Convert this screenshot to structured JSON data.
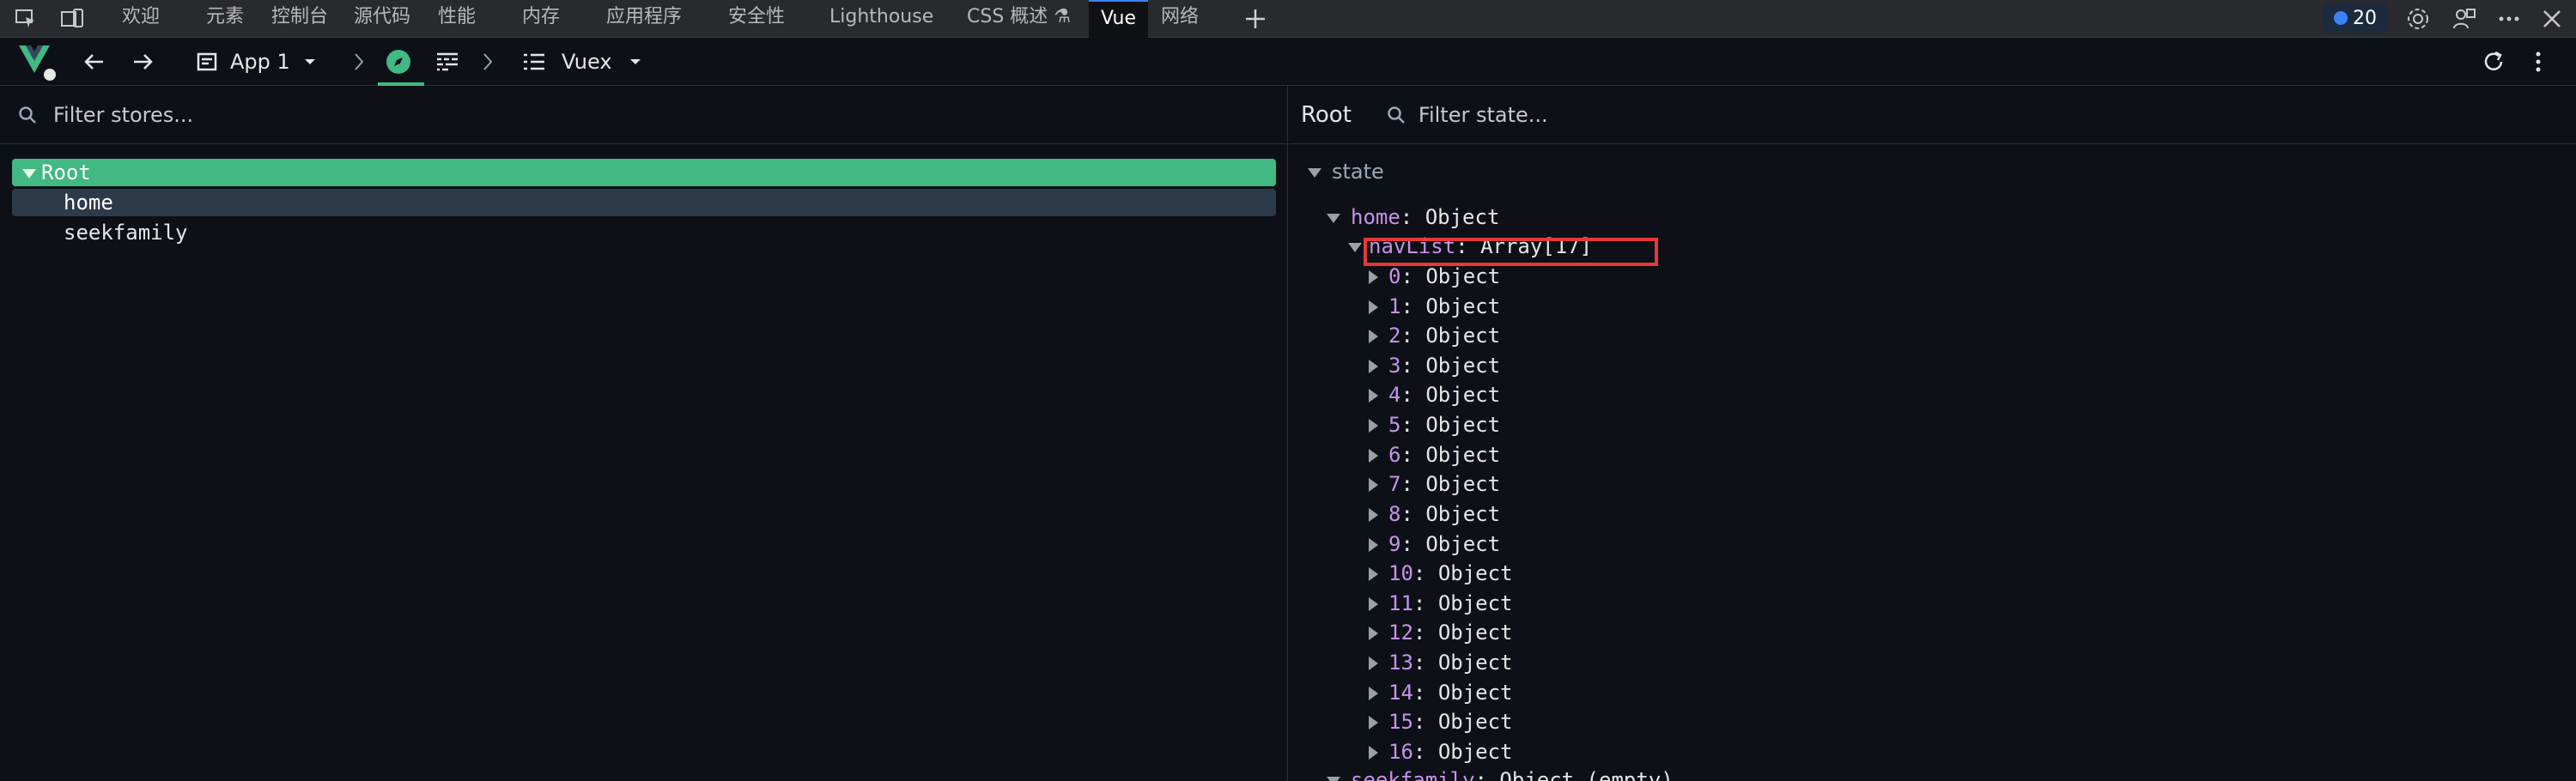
{
  "devtools_tabs": [
    "欢迎",
    "元素",
    "控制台",
    "源代码",
    "性能",
    "内存",
    "应用程序",
    "安全性",
    "Lighthouse",
    "CSS 概述 ⚗",
    "Vue",
    "网络"
  ],
  "issues_count": "20",
  "vue_toolbar": {
    "app_label": "App 1",
    "vuex_label": "Vuex"
  },
  "left_pane": {
    "filter_placeholder": "Filter stores...",
    "stores": [
      {
        "label": "Root",
        "state": "selected"
      },
      {
        "label": "home",
        "state": "hover"
      },
      {
        "label": "seekfamily",
        "state": "normal"
      }
    ]
  },
  "right_pane": {
    "title": "Root",
    "filter_placeholder": "Filter state...",
    "section": "state",
    "home_key": "home",
    "home_type": "Object",
    "navlist_key": "navList",
    "navlist_type": "Array[17]",
    "items": [
      {
        "key": "0",
        "type": "Object"
      },
      {
        "key": "1",
        "type": "Object"
      },
      {
        "key": "2",
        "type": "Object"
      },
      {
        "key": "3",
        "type": "Object"
      },
      {
        "key": "4",
        "type": "Object"
      },
      {
        "key": "5",
        "type": "Object"
      },
      {
        "key": "6",
        "type": "Object"
      },
      {
        "key": "7",
        "type": "Object"
      },
      {
        "key": "8",
        "type": "Object"
      },
      {
        "key": "9",
        "type": "Object"
      },
      {
        "key": "10",
        "type": "Object"
      },
      {
        "key": "11",
        "type": "Object"
      },
      {
        "key": "12",
        "type": "Object"
      },
      {
        "key": "13",
        "type": "Object"
      },
      {
        "key": "14",
        "type": "Object"
      },
      {
        "key": "15",
        "type": "Object"
      },
      {
        "key": "16",
        "type": "Object"
      }
    ],
    "seekfamily_key": "seekfamily",
    "seekfamily_type": "Object (empty)"
  },
  "colors": {
    "vue_green": "#42b883",
    "key_purple": "#c792ea",
    "highlight_red": "#e53935"
  }
}
